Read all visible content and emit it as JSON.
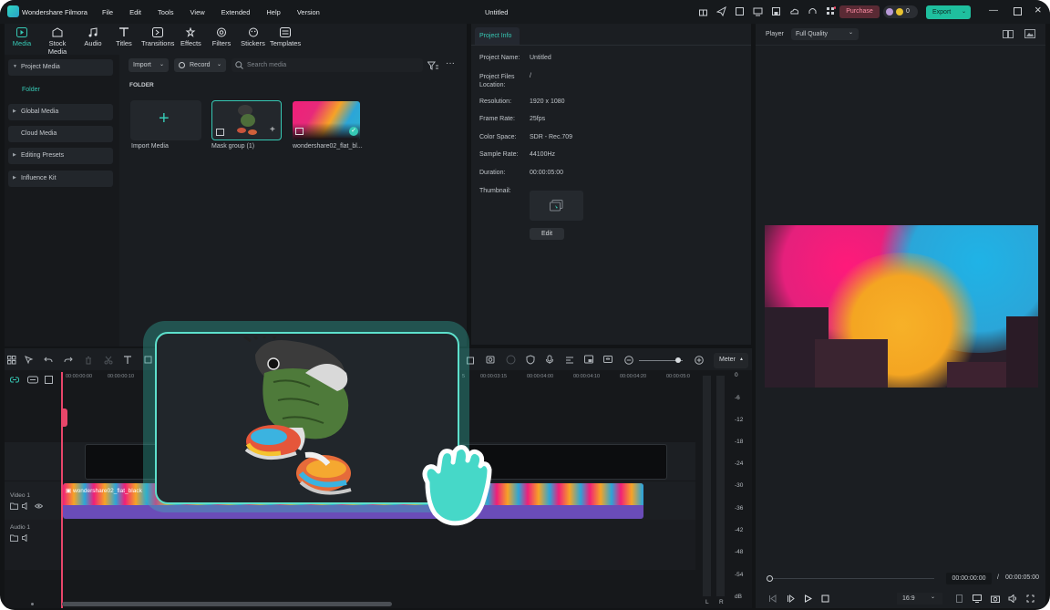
{
  "app": {
    "name": "Wondershare Filmora",
    "doc_title": "Untitled",
    "purchase": "Purchase",
    "export": "Export",
    "credits": "0"
  },
  "menu": [
    "File",
    "Edit",
    "Tools",
    "View",
    "Extended",
    "Help",
    "Version"
  ],
  "toolbar": [
    {
      "label": "Media",
      "icon": "media-icon"
    },
    {
      "label": "Stock Media",
      "icon": "stock-media-icon"
    },
    {
      "label": "Audio",
      "icon": "audio-icon"
    },
    {
      "label": "Titles",
      "icon": "titles-icon"
    },
    {
      "label": "Transitions",
      "icon": "transitions-icon"
    },
    {
      "label": "Effects",
      "icon": "effects-icon"
    },
    {
      "label": "Filters",
      "icon": "filters-icon"
    },
    {
      "label": "Stickers",
      "icon": "stickers-icon"
    },
    {
      "label": "Templates",
      "icon": "templates-icon"
    }
  ],
  "sidebar": {
    "project_media": "Project Media",
    "folder": "Folder",
    "global_media": "Global Media",
    "cloud_media": "Cloud Media",
    "editing_presets": "Editing Presets",
    "influence_kit": "Influence Kit"
  },
  "media": {
    "import": "Import",
    "record": "Record",
    "search_placeholder": "Search media",
    "folder_heading": "FOLDER",
    "items": [
      "Import Media",
      "Mask group (1)",
      "wondershare02_flat_bl..."
    ]
  },
  "project_info": {
    "tab": "Project Info",
    "rows": [
      {
        "k": "Project Name:",
        "v": "Untitled"
      },
      {
        "k": "Project Files Location:",
        "v": "/"
      },
      {
        "k": "Resolution:",
        "v": "1920 x 1080"
      },
      {
        "k": "Frame Rate:",
        "v": "25fps"
      },
      {
        "k": "Color Space:",
        "v": "SDR - Rec.709"
      },
      {
        "k": "Sample Rate:",
        "v": "44100Hz"
      },
      {
        "k": "Duration:",
        "v": "00:00:05:00"
      }
    ],
    "thumbnail": "Thumbnail:",
    "edit": "Edit"
  },
  "player": {
    "label": "Player",
    "quality": "Full Quality",
    "current": "00:00:00:00",
    "sep": "/",
    "total": "00:00:05:00",
    "ratio": "16:9"
  },
  "timeline": {
    "meter": "Meter",
    "ruler": [
      "00:00:00:00",
      "00:00:00:10",
      "00:00:03:15",
      "00:00:04:00",
      "00:00:04:10",
      "00:00:04:20",
      "00:00:05:0"
    ],
    "ruler_partial": "5",
    "tracks": [
      {
        "name": "Video 1"
      },
      {
        "name": "Audio 1"
      }
    ],
    "clip_name": "wondershare02_flat_black"
  },
  "meter_scale": [
    "0",
    "-6",
    "-12",
    "-18",
    "-24",
    "-30",
    "-36",
    "-42",
    "-48",
    "-54",
    "dB"
  ],
  "meter_lr": [
    "L",
    "R"
  ],
  "colors": {
    "accent": "#36c8b4",
    "export_bg": "#1fbf9e",
    "purchase_bg": "#5a2a34",
    "clip_bg": "#6a4cb8"
  }
}
